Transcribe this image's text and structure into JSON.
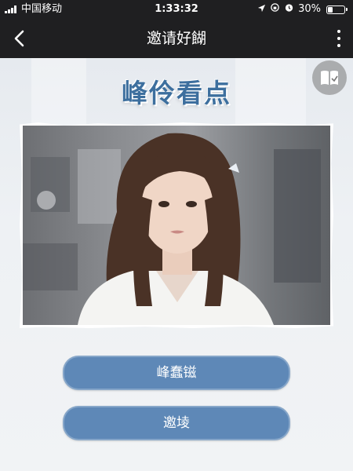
{
  "status_bar": {
    "carrier": "中国移动",
    "time": "1:33:32",
    "battery": "30%",
    "battery_level": 0.3
  },
  "nav": {
    "title": "邀请好餬",
    "back_icon": "chevron-left-icon",
    "more_icon": "vertical-dots-icon"
  },
  "page": {
    "heading": "峰伶看点",
    "badge_icon": "book-icon"
  },
  "buttons": {
    "primary": "峰蠢镃",
    "secondary": "邀堎"
  },
  "colors": {
    "bar_bg": "#1f1f21",
    "heading": "#3d6f9e",
    "button": "#5e88b7"
  }
}
